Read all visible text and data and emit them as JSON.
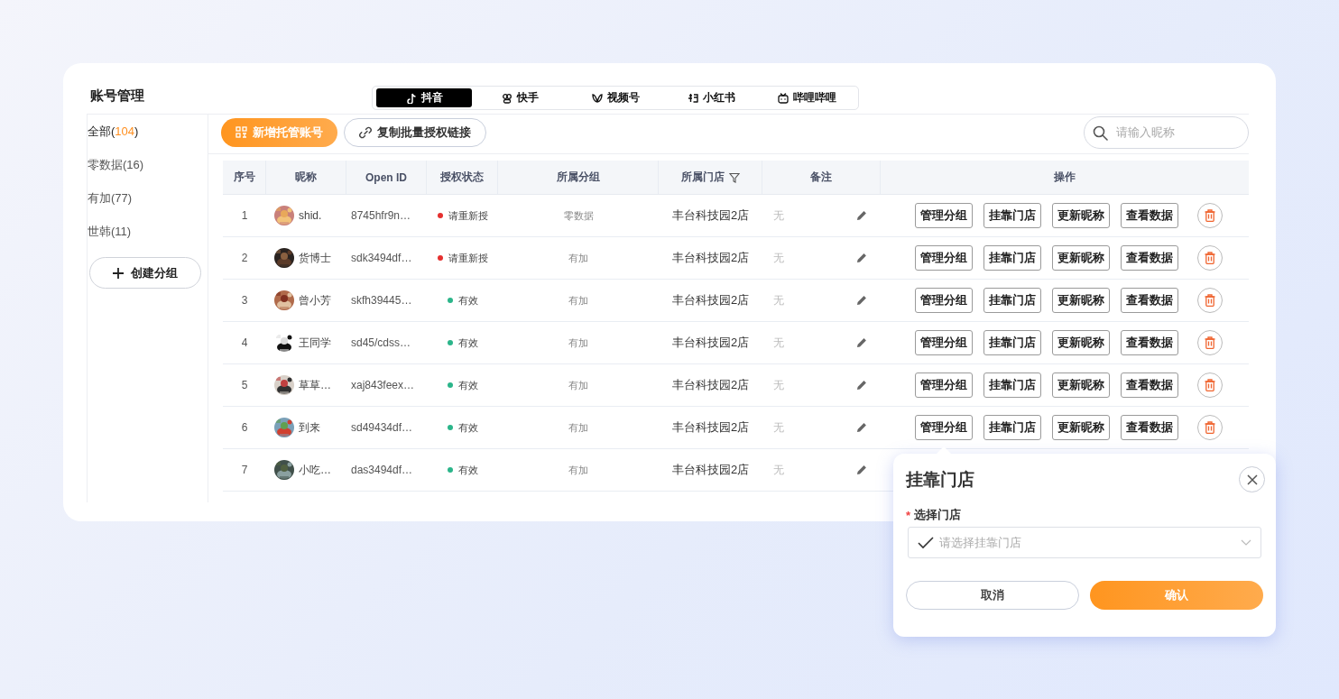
{
  "header": {
    "title": "账号管理"
  },
  "platform_tabs": [
    {
      "label": "抖音",
      "selected": true
    },
    {
      "label": "快手",
      "selected": false
    },
    {
      "label": "视频号",
      "selected": false
    },
    {
      "label": "小红书",
      "selected": false
    },
    {
      "label": "哔哩哔哩",
      "selected": false
    }
  ],
  "groups": [
    {
      "label": "全部(",
      "count": "104",
      "close": ")",
      "selected": true
    },
    {
      "label": "零数据(",
      "count": "16",
      "close": ")",
      "selected": false
    },
    {
      "label": "有加(",
      "count": "77",
      "close": ")",
      "selected": false
    },
    {
      "label": "世韩(",
      "count": "11",
      "close": ")",
      "selected": false
    }
  ],
  "create_group_button": {
    "label": "创建分组"
  },
  "toolbar": {
    "add_button": "新增托管账号",
    "copy_link_button": "复制批量授权链接",
    "search": {
      "placeholder": "请输入昵称"
    }
  },
  "table": {
    "columns": [
      {
        "label": "序号",
        "filter": false
      },
      {
        "label": "昵称",
        "filter": false
      },
      {
        "label": "Open ID",
        "filter": false
      },
      {
        "label": "授权状态",
        "filter": false
      },
      {
        "label": "所属分组",
        "filter": false
      },
      {
        "label": "所属门店",
        "filter": true
      },
      {
        "label": "备注",
        "filter": false
      },
      {
        "label": "操作",
        "filter": false
      }
    ],
    "rows": [
      {
        "index": "1",
        "nickname": "shid.",
        "open_id": "8745hfr9n…",
        "status": {
          "label": "请重新授",
          "color": "#e5302f"
        },
        "group": "零数据",
        "store": "丰台科技园2店",
        "remark": "无",
        "actions": [
          "管理分组",
          "挂靠门店",
          "更新昵称",
          "查看数据"
        ]
      },
      {
        "index": "2",
        "nickname": "货博士",
        "open_id": "sdk3494df…",
        "status": {
          "label": "请重新授",
          "color": "#e5302f"
        },
        "group": "有加",
        "store": "丰台科技园2店",
        "remark": "无",
        "actions": [
          "管理分组",
          "挂靠门店",
          "更新昵称",
          "查看数据"
        ]
      },
      {
        "index": "3",
        "nickname": "曾小芳",
        "open_id": "skfh39445…",
        "status": {
          "label": "有效",
          "color": "#2bb58a"
        },
        "group": "有加",
        "store": "丰台科技园2店",
        "remark": "无",
        "actions": [
          "管理分组",
          "挂靠门店",
          "更新昵称",
          "查看数据"
        ]
      },
      {
        "index": "4",
        "nickname": "王同学",
        "open_id": "sd45/cdss…",
        "status": {
          "label": "有效",
          "color": "#2bb58a"
        },
        "group": "有加",
        "store": "丰台科技园2店",
        "remark": "无",
        "actions": [
          "管理分组",
          "挂靠门店",
          "更新昵称",
          "查看数据"
        ]
      },
      {
        "index": "5",
        "nickname": "草草…",
        "open_id": "xaj843feex…",
        "status": {
          "label": "有效",
          "color": "#2bb58a"
        },
        "group": "有加",
        "store": "丰台科技园2店",
        "remark": "无",
        "actions": [
          "管理分组",
          "挂靠门店",
          "更新昵称",
          "查看数据"
        ]
      },
      {
        "index": "6",
        "nickname": "到来",
        "open_id": "sd49434df…",
        "status": {
          "label": "有效",
          "color": "#2bb58a"
        },
        "group": "有加",
        "store": "丰台科技园2店",
        "remark": "无",
        "actions": [
          "管理分组",
          "挂靠门店",
          "更新昵称",
          "查看数据"
        ]
      },
      {
        "index": "7",
        "nickname": "小吃…",
        "open_id": "das3494df…",
        "status": {
          "label": "有效",
          "color": "#2bb58a"
        },
        "group": "有加",
        "store": "丰台科技园2店",
        "remark": "无"
      }
    ]
  },
  "popover": {
    "title": "挂靠门店",
    "field": {
      "required_mark": "*",
      "label": "选择门店",
      "placeholder": "请选择挂靠门店"
    },
    "buttons": [
      {
        "label": "取消",
        "kind": "secondary"
      },
      {
        "label": "确认",
        "kind": "primary"
      }
    ]
  }
}
